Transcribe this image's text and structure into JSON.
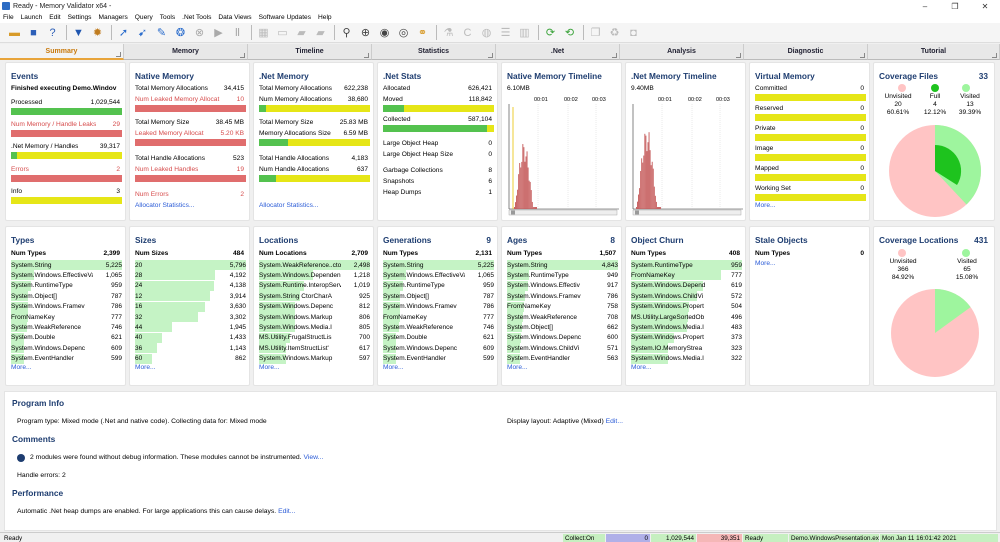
{
  "window": {
    "title": "Ready - Memory Validator x64 -",
    "min": "–",
    "max": "❐",
    "close": "✕"
  },
  "menu": [
    "File",
    "Launch",
    "Edit",
    "Settings",
    "Managers",
    "Query",
    "Tools",
    ".Net Tools",
    "Data Views",
    "Software Updates",
    "Help"
  ],
  "tabs": [
    "Summary",
    "Memory",
    "Timeline",
    "Statistics",
    ".Net",
    "Analysis",
    "Diagnostic",
    "Tutorial"
  ],
  "events": {
    "title": "Events",
    "executing": "Finished executing Demo.Windov",
    "processed_label": "Processed",
    "processed_value": "1,029,544",
    "leaks_label": "Num Memory / Handle Leaks",
    "leaks_value": "29",
    "net_label": ".Net Memory / Handles",
    "net_value": "39,317",
    "errors_label": "Errors",
    "errors_value": "2",
    "info_label": "Info",
    "info_value": "3"
  },
  "native": {
    "title": "Native Memory",
    "r1": "Total Memory Allocations",
    "v1": "34,415",
    "r2": "Num Leaked Memory Allocat",
    "v2": "10",
    "r3": "Total Memory Size",
    "v3": "38.45 MB",
    "r4": "Leaked Memory Allocat",
    "v4": "5.20 KB",
    "r5": "Total Handle Allocations",
    "v5": "523",
    "r6": "Num Leaked Handles",
    "v6": "19",
    "r7": "Num Errors",
    "v7": "2",
    "link": "Allocator Statistics..."
  },
  "netmem": {
    "title": ".Net Memory",
    "r1": "Total Memory Allocations",
    "v1": "622,238",
    "r2": "Num Memory Allocations",
    "v2": "38,680",
    "r3": "Total Memory Size",
    "v3": "25.83 MB",
    "r4": "Memory Allocations Size",
    "v4": "6.59 MB",
    "r5": "Total Handle Allocations",
    "v5": "4,183",
    "r6": "Num Handle Allocations",
    "v6": "637",
    "link": "Allocator Statistics..."
  },
  "netstats": {
    "title": ".Net Stats",
    "r1": "Allocated",
    "v1": "626,421",
    "r2": "Moved",
    "v2": "118,842",
    "r3": "Collected",
    "v3": "587,104",
    "r4": "Large Object Heap",
    "v4": "0",
    "r5": "Large Object Heap Size",
    "v5": "0",
    "r6": "Garbage Collections",
    "v6": "8",
    "r7": "Snapshots",
    "v7": "6",
    "r8": "Heap Dumps",
    "v8": "1"
  },
  "nmtimeline": {
    "title": "Native Memory Timeline",
    "size": "6.10MB",
    "t1": "00:01",
    "t2": "00:02",
    "t3": "00:03"
  },
  "netmtimeline": {
    "title": ".Net Memory Timeline",
    "size": "9.40MB",
    "t1": "00:01",
    "t2": "00:02",
    "t3": "00:03"
  },
  "virtual": {
    "title": "Virtual Memory",
    "items": [
      {
        "label": "Committed",
        "value": "0"
      },
      {
        "label": "Reserved",
        "value": "0"
      },
      {
        "label": "Private",
        "value": "0"
      },
      {
        "label": "Image",
        "value": "0"
      },
      {
        "label": "Mapped",
        "value": "0"
      },
      {
        "label": "Working Set",
        "value": "0"
      }
    ],
    "more": "More..."
  },
  "coverage_files": {
    "title": "Coverage Files",
    "count": "33",
    "unvisited_label": "Unvisited",
    "unvisited_count": "20",
    "unvisited_pct": "60.61%",
    "full_label": "Full",
    "full_count": "4",
    "full_pct": "12.12%",
    "visited_label": "Visited",
    "visited_count": "13",
    "visited_pct": "39.39%",
    "colors": {
      "unvisited": "#ffc4c4",
      "full": "#1ec31e",
      "visited": "#9ef59e"
    }
  },
  "types": {
    "title": "Types",
    "header_label": "Num Types",
    "header_value": "2,399",
    "rows": [
      {
        "name": "System.String",
        "value": "5,225"
      },
      {
        "name": "System.Windows.EffectiveVa",
        "value": "1,065"
      },
      {
        "name": "System.RuntimeType",
        "value": "959"
      },
      {
        "name": "System.Object[]",
        "value": "787"
      },
      {
        "name": "System.Windows.Framev",
        "value": "786"
      },
      {
        "name": "FromNameKey",
        "value": "777"
      },
      {
        "name": "System.WeakReference",
        "value": "746"
      },
      {
        "name": "System.Double",
        "value": "621"
      },
      {
        "name": "System.Windows.Depenc",
        "value": "609"
      },
      {
        "name": "System.EventHandler",
        "value": "599"
      }
    ],
    "more": "More..."
  },
  "sizes": {
    "title": "Sizes",
    "header_label": "Num Sizes",
    "header_value": "484",
    "rows": [
      {
        "name": "20",
        "value": "5,796"
      },
      {
        "name": "28",
        "value": "4,192"
      },
      {
        "name": "24",
        "value": "4,138"
      },
      {
        "name": "12",
        "value": "3,914"
      },
      {
        "name": "16",
        "value": "3,630"
      },
      {
        "name": "32",
        "value": "3,302"
      },
      {
        "name": "44",
        "value": "1,945"
      },
      {
        "name": "40",
        "value": "1,433"
      },
      {
        "name": "36",
        "value": "1,143"
      },
      {
        "name": "60",
        "value": "862"
      }
    ],
    "more": "More..."
  },
  "locations": {
    "title": "Locations",
    "header_label": "Num Locations",
    "header_value": "2,709",
    "rows": [
      {
        "name": "System.WeakReference..cto",
        "value": "2,498"
      },
      {
        "name": "System.Windows.Dependen",
        "value": "1,218"
      },
      {
        "name": "System.Runtime.InteropServi",
        "value": "1,019"
      },
      {
        "name": "System.String CtorCharA",
        "value": "925"
      },
      {
        "name": "System.Windows.Depenc",
        "value": "812"
      },
      {
        "name": "System.Windows.Markup",
        "value": "806"
      },
      {
        "name": "System.Windows.Media.I",
        "value": "805"
      },
      {
        "name": "MS.Utility.FrugalStructLis",
        "value": "700"
      },
      {
        "name": "MS.Utility.ItemStructList'",
        "value": "617"
      },
      {
        "name": "System.Windows.Markup",
        "value": "597"
      }
    ],
    "more": "More..."
  },
  "generations": {
    "title": "Generations",
    "count": "9",
    "header_label": "Num Types",
    "header_value": "2,131",
    "rows": [
      {
        "name": "System.String",
        "value": "5,225"
      },
      {
        "name": "System.Windows.EffectiveVa",
        "value": "1,065"
      },
      {
        "name": "System.RuntimeType",
        "value": "959"
      },
      {
        "name": "System.Object[]",
        "value": "787"
      },
      {
        "name": "System.Windows.Framev",
        "value": "786"
      },
      {
        "name": "FromNameKey",
        "value": "777"
      },
      {
        "name": "System.WeakReference",
        "value": "746"
      },
      {
        "name": "System.Double",
        "value": "621"
      },
      {
        "name": "System.Windows.Depenc",
        "value": "609"
      },
      {
        "name": "System.EventHandler",
        "value": "599"
      }
    ],
    "more": "More..."
  },
  "ages": {
    "title": "Ages",
    "count": "8",
    "header_label": "Num Types",
    "header_value": "1,507",
    "rows": [
      {
        "name": "System.String",
        "value": "4,843"
      },
      {
        "name": "System.RuntimeType",
        "value": "949"
      },
      {
        "name": "System.Windows.Effectiv",
        "value": "917"
      },
      {
        "name": "System.Windows.Framev",
        "value": "786"
      },
      {
        "name": "FromNameKey",
        "value": "758"
      },
      {
        "name": "System.WeakReference",
        "value": "708"
      },
      {
        "name": "System.Object[]",
        "value": "662"
      },
      {
        "name": "System.Windows.Depenc",
        "value": "600"
      },
      {
        "name": "System.Windows.ChildVi",
        "value": "571"
      },
      {
        "name": "System.EventHandler",
        "value": "563"
      }
    ],
    "more": "More..."
  },
  "churn": {
    "title": "Object Churn",
    "header_label": "Num Types",
    "header_value": "408",
    "rows": [
      {
        "name": "System.RuntimeType",
        "value": "959"
      },
      {
        "name": "FromNameKey",
        "value": "777"
      },
      {
        "name": "System.Windows.Depend",
        "value": "619"
      },
      {
        "name": "System.Windows.ChildVi",
        "value": "572"
      },
      {
        "name": "System.Windows.Propert",
        "value": "504"
      },
      {
        "name": "MS.Utility.LargeSortedOb",
        "value": "496"
      },
      {
        "name": "System.Windows.Media.I",
        "value": "483"
      },
      {
        "name": "System.Windows.Propert",
        "value": "373"
      },
      {
        "name": "System.IO.MemoryStrea",
        "value": "323"
      },
      {
        "name": "System.Windows.Media.I",
        "value": "322"
      }
    ],
    "more": "More..."
  },
  "stale": {
    "title": "Stale Objects",
    "header_label": "Num Types",
    "header_value": "0",
    "more": "More..."
  },
  "coverage_locations": {
    "title": "Coverage Locations",
    "count": "431",
    "unvisited_label": "Unvisited",
    "unvisited_count": "366",
    "unvisited_pct": "84.92%",
    "visited_label": "Visited",
    "visited_count": "65",
    "visited_pct": "15.08%"
  },
  "program_info": {
    "title": "Program Info",
    "text": "Program type: Mixed mode (.Net and native code). Collecting data for: Mixed mode",
    "layout_text": "Display layout: Adaptive (Mixed)",
    "edit": "Edit..."
  },
  "comments": {
    "title": "Comments",
    "text": "2 modules were found without debug information. These modules cannot be instrumented.",
    "view": "View...",
    "errors": "Handle errors: 2"
  },
  "performance": {
    "title": "Performance",
    "text": "Automatic .Net heap dumps are enabled. For large applications this can cause delays.",
    "edit": "Edit..."
  },
  "status": {
    "left": "Ready",
    "collect": "Collect:On",
    "v1": "0",
    "v2": "1,029,544",
    "v3": "39,351",
    "ready": "Ready",
    "exe": "Demo.WindowsPresentation.exe",
    "date": "Mon Jan 11 16:01:42 2021"
  }
}
